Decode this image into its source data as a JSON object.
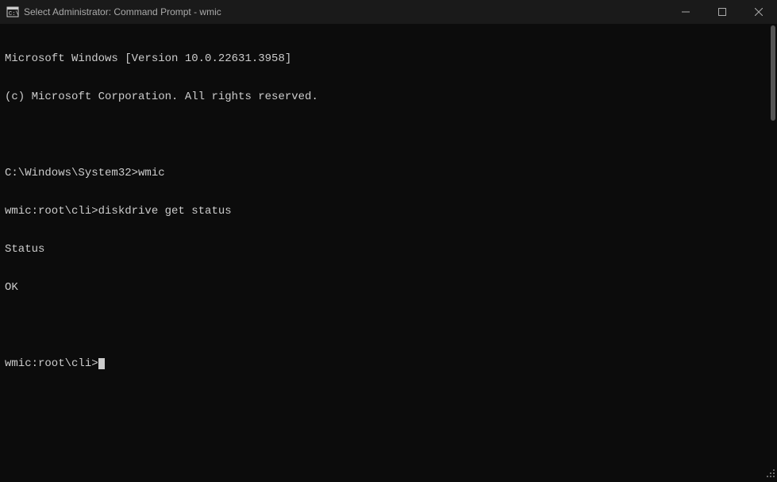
{
  "window": {
    "title": "Select Administrator: Command Prompt - wmic"
  },
  "terminal": {
    "lines": [
      "Microsoft Windows [Version 10.0.22631.3958]",
      "(c) Microsoft Corporation. All rights reserved.",
      "",
      "C:\\Windows\\System32>wmic",
      "wmic:root\\cli>diskdrive get status",
      "Status",
      "OK",
      "",
      "wmic:root\\cli>"
    ]
  }
}
